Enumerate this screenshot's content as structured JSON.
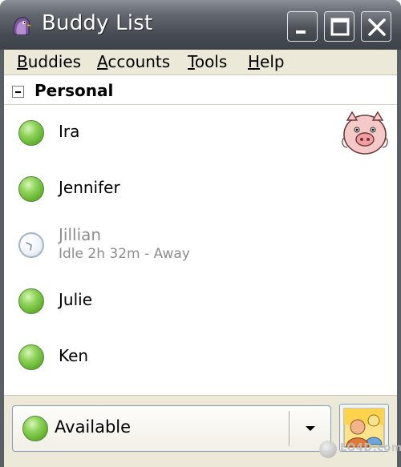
{
  "window": {
    "title": "Buddy List"
  },
  "menubar": {
    "items": [
      {
        "label": "Buddies",
        "accel": "B"
      },
      {
        "label": "Accounts",
        "accel": "A"
      },
      {
        "label": "Tools",
        "accel": "T"
      },
      {
        "label": "Help",
        "accel": "H"
      }
    ]
  },
  "group": {
    "name": "Personal",
    "toggle_icon": "collapse-minus-icon"
  },
  "buddies": [
    {
      "name": "Ira",
      "status": "available",
      "status_text": ""
    },
    {
      "name": "Jennifer",
      "status": "available",
      "status_text": ""
    },
    {
      "name": "Jillian",
      "status": "idle",
      "status_text": "Idle 2h 32m - Away"
    },
    {
      "name": "Julie",
      "status": "available",
      "status_text": ""
    },
    {
      "name": "Ken",
      "status": "available",
      "status_text": ""
    }
  ],
  "status_selector": {
    "label": "Available",
    "icon": "available-status-icon"
  },
  "watermark": {
    "text": "LO4D.com"
  },
  "colors": {
    "titlebar": "#474c54",
    "available": "#5fae2d",
    "idle_text": "#8d8d8d",
    "menubar": "#ece9d8"
  }
}
